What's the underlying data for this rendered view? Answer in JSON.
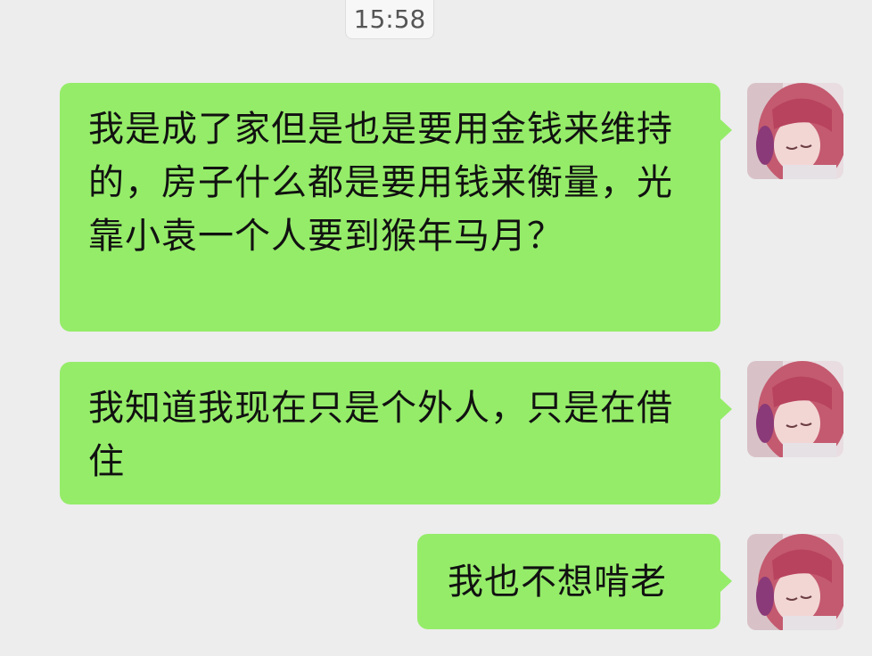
{
  "chat": {
    "timestamp": "15:58",
    "messages": [
      {
        "text": "我是成了家但是也是要用金钱来维持的，房子什么都是要用钱来衡量，光靠小袁一个人要到猴年马月？",
        "sender": "me"
      },
      {
        "text": "我知道我现在只是个外人，只是在借住",
        "sender": "me"
      },
      {
        "text": "我也不想啃老",
        "sender": "me"
      }
    ]
  },
  "colors": {
    "background": "#ededed",
    "bubble": "#95ec69",
    "hair": "#c45a6f"
  },
  "icons": {
    "avatar": "user-avatar-icon"
  }
}
